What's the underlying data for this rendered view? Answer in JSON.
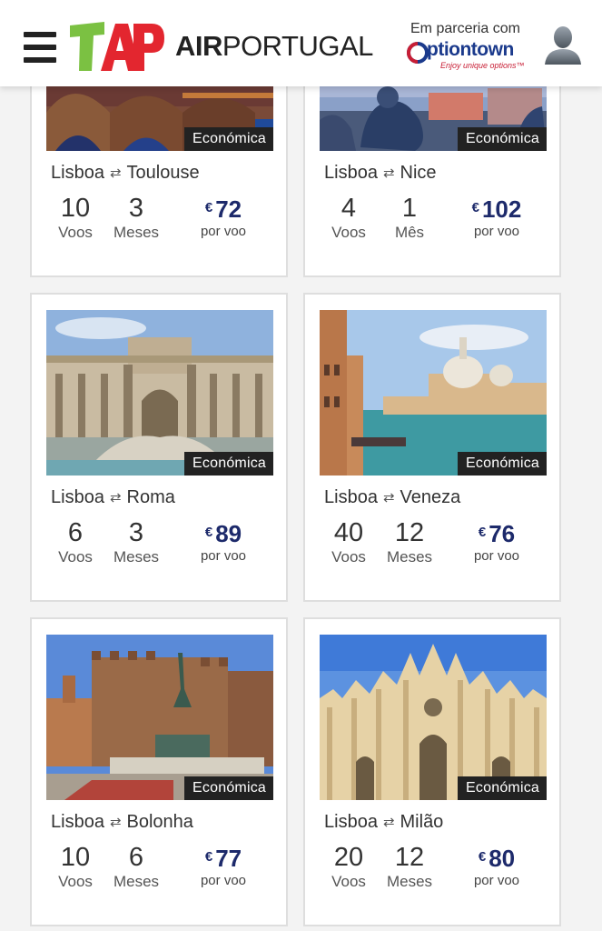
{
  "header": {
    "brand_name_bold": "AIR",
    "brand_name_rest": "PORTUGAL",
    "partner_label": "Em parceria com",
    "partner_name": "ptiontown",
    "partner_tagline": "Enjoy unique options™"
  },
  "cards": [
    {
      "origin": "Lisboa",
      "destination": "Toulouse",
      "cabin": "Económica",
      "flights": "10",
      "flights_label": "Voos",
      "months": "3",
      "months_label": "Meses",
      "currency": "€",
      "price": "72",
      "price_label": "por voo"
    },
    {
      "origin": "Lisboa",
      "destination": "Nice",
      "cabin": "Económica",
      "flights": "4",
      "flights_label": "Voos",
      "months": "1",
      "months_label": "Mês",
      "currency": "€",
      "price": "102",
      "price_label": "por voo"
    },
    {
      "origin": "Lisboa",
      "destination": "Roma",
      "cabin": "Económica",
      "flights": "6",
      "flights_label": "Voos",
      "months": "3",
      "months_label": "Meses",
      "currency": "€",
      "price": "89",
      "price_label": "por voo"
    },
    {
      "origin": "Lisboa",
      "destination": "Veneza",
      "cabin": "Económica",
      "flights": "40",
      "flights_label": "Voos",
      "months": "12",
      "months_label": "Meses",
      "currency": "€",
      "price": "76",
      "price_label": "por voo"
    },
    {
      "origin": "Lisboa",
      "destination": "Bolonha",
      "cabin": "Económica",
      "flights": "10",
      "flights_label": "Voos",
      "months": "6",
      "months_label": "Meses",
      "currency": "€",
      "price": "77",
      "price_label": "por voo"
    },
    {
      "origin": "Lisboa",
      "destination": "Milão",
      "cabin": "Económica",
      "flights": "20",
      "flights_label": "Voos",
      "months": "12",
      "months_label": "Meses",
      "currency": "€",
      "price": "80",
      "price_label": "por voo"
    }
  ],
  "colors": {
    "price": "#1d2a6b",
    "tap_green": "#7bc142",
    "tap_red": "#e3262f",
    "badge": "#222222"
  },
  "icons": {
    "menu": "hamburger-icon",
    "user": "user-avatar-icon",
    "route": "swap-arrows-icon"
  }
}
